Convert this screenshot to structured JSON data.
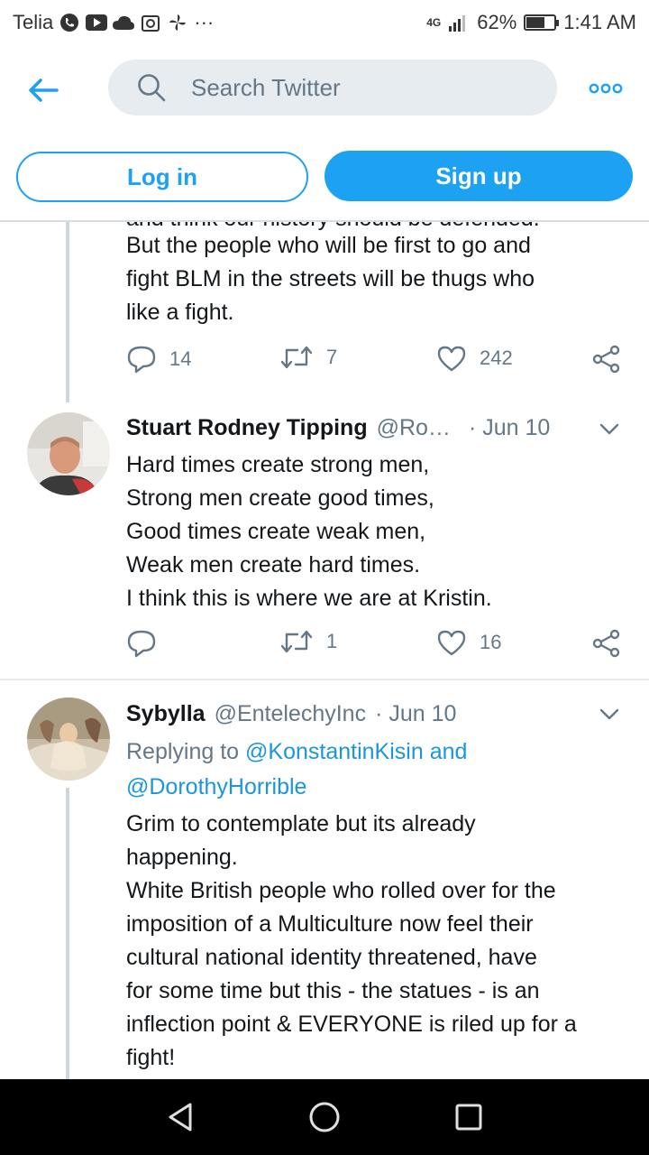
{
  "status_bar": {
    "carrier": "Telia",
    "network": "4G",
    "battery_percent": "62%",
    "battery_level": 0.62,
    "time": "1:41 AM",
    "more": "···"
  },
  "header": {
    "search_placeholder": "Search Twitter"
  },
  "auth": {
    "login_label": "Log in",
    "signup_label": "Sign up"
  },
  "tweets": [
    {
      "text_cut": "and think our history should be defended.",
      "text": "But the people who will be first to go and\nfight BLM in the streets will be thugs who\nlike a fight.",
      "reply_count": "14",
      "retweet_count": "7",
      "like_count": "242"
    },
    {
      "name": "Stuart Rodney Tipping",
      "handle": "@Ro…",
      "date": "· Jun 10",
      "text": "Hard times create strong men,\nStrong men create good times,\nGood times create weak men,\nWeak men create hard times.\nI think this is where we are at Kristin.",
      "reply_count": "",
      "retweet_count": "1",
      "like_count": "16"
    },
    {
      "name": "Sybylla",
      "handle": "@EntelechyInc",
      "date": "· Jun 10",
      "replying_prefix": "Replying to ",
      "mention_1": "@KonstantinKisin",
      "and_word": " and",
      "mention_2": "@DorothyHorrible",
      "text": "Grim to contemplate but its already\nhappening.\nWhite British people who rolled over for the\nimposition of a Multiculture now feel their\ncultural national identity threatened, have\nfor some time but this - the statues - is an\ninflection point & EVERYONE is riled up for a\nfight!"
    }
  ],
  "colors": {
    "accent": "#1da1f2",
    "muted": "#657786",
    "text": "#14171a"
  }
}
